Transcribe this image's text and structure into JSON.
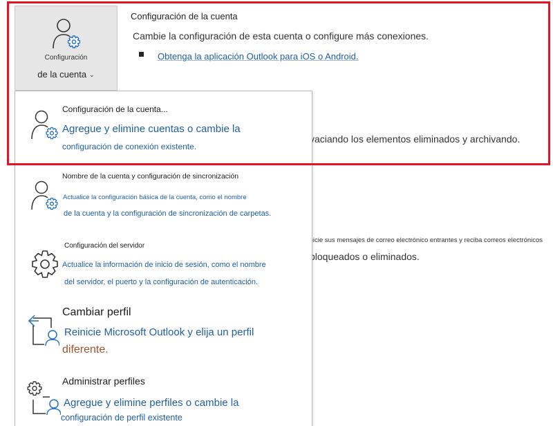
{
  "account_button": {
    "line1": "Configuración",
    "line2": "de la cuenta",
    "icon": "user-gear-icon",
    "chevron": "chevron-down-icon"
  },
  "section": {
    "title": "Configuración de la cuenta",
    "description": "Cambie la configuración de esta cuenta o configure más conexiones.",
    "link": "Obtenga la aplicación Outlook para iOS o Android."
  },
  "background": {
    "mailbox_text": "vaciando los elementos eliminados y archivando.",
    "rules_text_1": "Inicie sus mensajes de correo electrónico entrantes y reciba correos electrónicos",
    "rules_text_2": "bloqueados o eliminados."
  },
  "menu": {
    "items": [
      {
        "title": "Configuración de la cuenta...",
        "desc1": "Agregue y elimine cuentas o cambie la",
        "desc2": "configuración de conexión existente.",
        "icon": "user-gear-icon"
      },
      {
        "title": "Nombre de la cuenta y configuración de sincronización",
        "desc1": "Actualice la configuración básica de la cuenta, como el nombre",
        "desc2": "de la cuenta y la configuración de sincronización de carpetas.",
        "icon": "user-gear-icon"
      },
      {
        "title": "Configuración del servidor",
        "desc1": "Actualice la información de inicio de sesión, como el nombre",
        "desc2": "del servidor, el puerto y la configuración de autenticación.",
        "icon": "gear-icon"
      },
      {
        "title": "Cambiar perfil",
        "desc1": "Reinicie Microsoft Outlook y elija un perfil",
        "desc2": "diferente.",
        "icon": "switch-profile-icon"
      },
      {
        "title": "Administrar perfiles",
        "desc1": "Agregue y elimine perfiles o cambie la",
        "desc2": "configuración de perfil existente",
        "icon": "manage-profiles-icon"
      }
    ]
  },
  "colors": {
    "link": "#1f5fa8",
    "highlight_frame": "#e81123",
    "warning_text": "#a0522d"
  }
}
